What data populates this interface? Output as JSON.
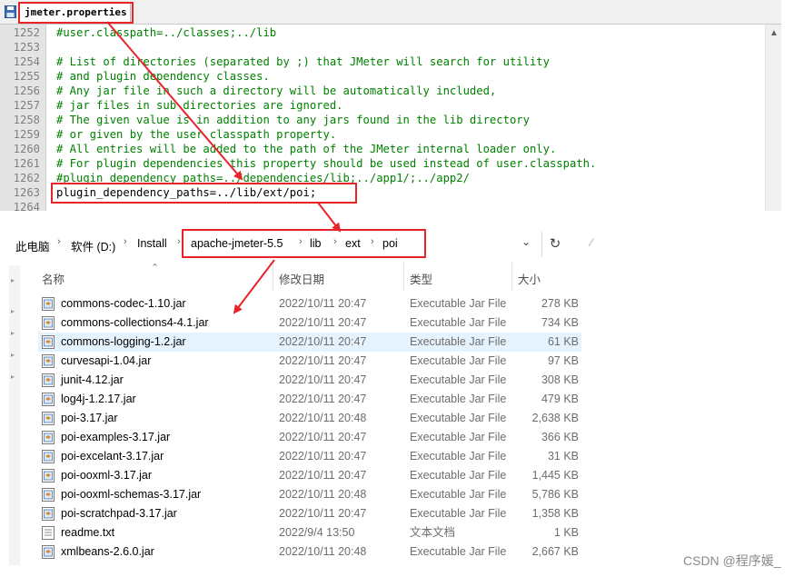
{
  "editor": {
    "tab_title": "jmeter.properties",
    "lines": [
      {
        "num": "1252",
        "text": "#user.classpath=../classes;../lib",
        "kind": "comment"
      },
      {
        "num": "1253",
        "text": "",
        "kind": "comment"
      },
      {
        "num": "1254",
        "text": "# List of directories (separated by ;) that JMeter will search for utility",
        "kind": "comment"
      },
      {
        "num": "1255",
        "text": "# and plugin dependency classes.",
        "kind": "comment"
      },
      {
        "num": "1256",
        "text": "# Any jar file in such a directory will be automatically included,",
        "kind": "comment"
      },
      {
        "num": "1257",
        "text": "# jar files in sub directories are ignored.",
        "kind": "comment"
      },
      {
        "num": "1258",
        "text": "# The given value is in addition to any jars found in the lib directory",
        "kind": "comment"
      },
      {
        "num": "1259",
        "text": "# or given by the user.classpath property.",
        "kind": "comment"
      },
      {
        "num": "1260",
        "text": "# All entries will be added to the path of the JMeter internal loader only.",
        "kind": "comment"
      },
      {
        "num": "1261",
        "text": "# For plugin dependencies this property should be used instead of user.classpath.",
        "kind": "comment"
      },
      {
        "num": "1262",
        "text": "#plugin_dependency_paths=../dependencies/lib;../app1/;../app2/",
        "kind": "comment"
      },
      {
        "num": "1263",
        "text": "plugin_dependency_paths=../lib/ext/poi;",
        "kind": "plain"
      },
      {
        "num": "1264",
        "text": "",
        "kind": "comment"
      }
    ]
  },
  "address_bar": {
    "crumbs": [
      "此电脑",
      "软件 (D:)",
      "Install",
      "apache-jmeter-5.5",
      "lib",
      "ext",
      "poi"
    ]
  },
  "columns": {
    "name": "名称",
    "date": "修改日期",
    "type": "类型",
    "size": "大小"
  },
  "files": [
    {
      "name": "commons-codec-1.10.jar",
      "date": "2022/10/11 20:47",
      "type": "Executable Jar File",
      "size": "278 KB",
      "icon": "jar-file-icon"
    },
    {
      "name": "commons-collections4-4.1.jar",
      "date": "2022/10/11 20:47",
      "type": "Executable Jar File",
      "size": "734 KB",
      "icon": "jar-file-icon"
    },
    {
      "name": "commons-logging-1.2.jar",
      "date": "2022/10/11 20:47",
      "type": "Executable Jar File",
      "size": "61 KB",
      "icon": "jar-file-icon"
    },
    {
      "name": "curvesapi-1.04.jar",
      "date": "2022/10/11 20:47",
      "type": "Executable Jar File",
      "size": "97 KB",
      "icon": "jar-file-icon"
    },
    {
      "name": "junit-4.12.jar",
      "date": "2022/10/11 20:47",
      "type": "Executable Jar File",
      "size": "308 KB",
      "icon": "jar-file-icon"
    },
    {
      "name": "log4j-1.2.17.jar",
      "date": "2022/10/11 20:47",
      "type": "Executable Jar File",
      "size": "479 KB",
      "icon": "jar-file-icon"
    },
    {
      "name": "poi-3.17.jar",
      "date": "2022/10/11 20:48",
      "type": "Executable Jar File",
      "size": "2,638 KB",
      "icon": "jar-file-icon"
    },
    {
      "name": "poi-examples-3.17.jar",
      "date": "2022/10/11 20:47",
      "type": "Executable Jar File",
      "size": "366 KB",
      "icon": "jar-file-icon"
    },
    {
      "name": "poi-excelant-3.17.jar",
      "date": "2022/10/11 20:47",
      "type": "Executable Jar File",
      "size": "31 KB",
      "icon": "jar-file-icon"
    },
    {
      "name": "poi-ooxml-3.17.jar",
      "date": "2022/10/11 20:47",
      "type": "Executable Jar File",
      "size": "1,445 KB",
      "icon": "jar-file-icon"
    },
    {
      "name": "poi-ooxml-schemas-3.17.jar",
      "date": "2022/10/11 20:48",
      "type": "Executable Jar File",
      "size": "5,786 KB",
      "icon": "jar-file-icon"
    },
    {
      "name": "poi-scratchpad-3.17.jar",
      "date": "2022/10/11 20:47",
      "type": "Executable Jar File",
      "size": "1,358 KB",
      "icon": "jar-file-icon"
    },
    {
      "name": "readme.txt",
      "date": "2022/9/4 13:50",
      "type": "文本文档",
      "size": "1 KB",
      "icon": "text-file-icon"
    },
    {
      "name": "xmlbeans-2.6.0.jar",
      "date": "2022/10/11 20:48",
      "type": "Executable Jar File",
      "size": "2,667 KB",
      "icon": "jar-file-icon"
    }
  ],
  "watermark": "CSDN @程序媛_",
  "colors": {
    "annotation": "#e8232a",
    "comment": "#008000",
    "row_highlight": "#e5f3ff"
  }
}
